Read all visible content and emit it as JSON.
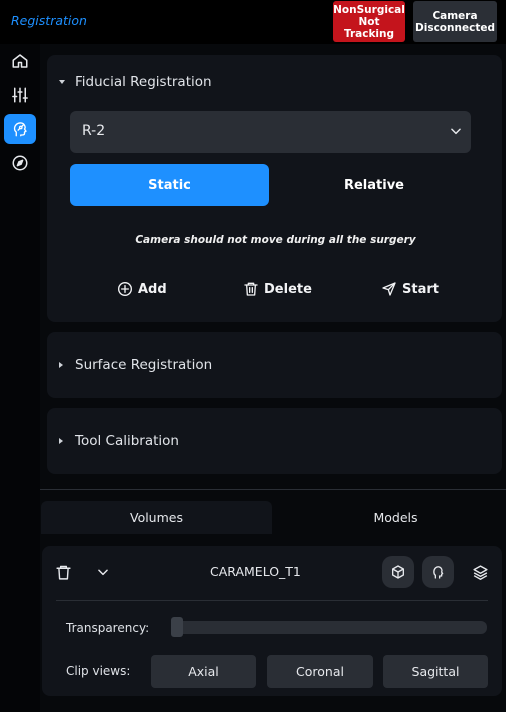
{
  "header": {
    "title": "Registration",
    "status_nonsurgical": "NonSurgical\nNot Tracking",
    "status_camera": "Camera\nDisconnected",
    "colors": {
      "accent": "#1e90ff",
      "alert": "#c4141c"
    }
  },
  "sidebar": {
    "items": [
      {
        "icon": "home-icon",
        "active": false
      },
      {
        "icon": "sliders-icon",
        "active": false
      },
      {
        "icon": "head-marker-icon",
        "active": true
      },
      {
        "icon": "compass-icon",
        "active": false
      }
    ]
  },
  "fiducial": {
    "title": "Fiducial Registration",
    "selected": "R-2",
    "mode_static": "Static",
    "mode_relative": "Relative",
    "hint": "Camera should not move during all the surgery",
    "add_label": "Add",
    "delete_label": "Delete",
    "start_label": "Start"
  },
  "surface": {
    "title": "Surface Registration"
  },
  "tool": {
    "title": "Tool Calibration"
  },
  "tabs": {
    "volumes": "Volumes",
    "models": "Models"
  },
  "volume": {
    "name": "CARAMELO_T1",
    "transparency_label": "Transparency:",
    "transparency_value": 0,
    "clip_label": "Clip views:",
    "clip_axial": "Axial",
    "clip_coronal": "Coronal",
    "clip_sagittal": "Sagittal"
  }
}
